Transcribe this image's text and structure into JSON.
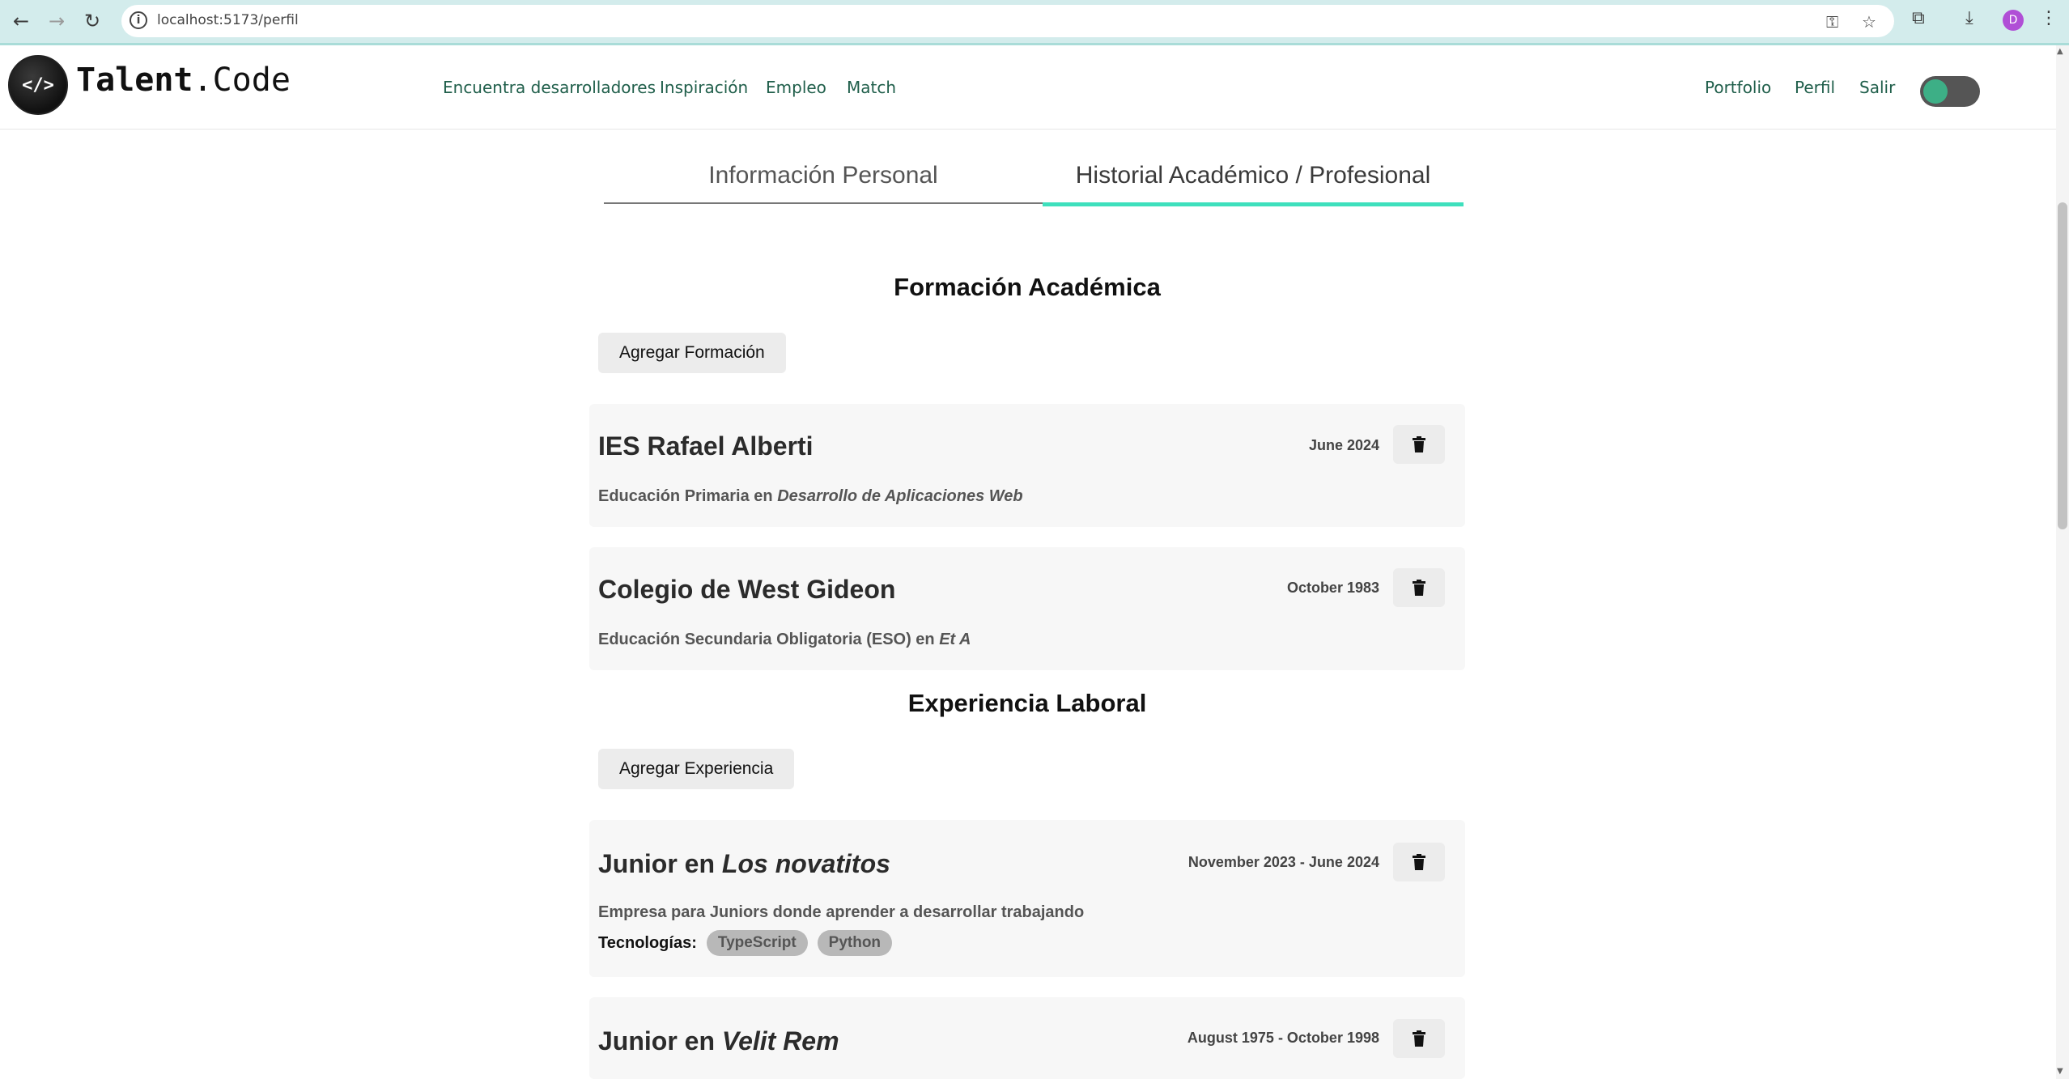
{
  "browser": {
    "url": "localhost:5173/perfil",
    "profile_initial": "D"
  },
  "header": {
    "logo_bold": "Talent",
    "logo_rest": ".Code",
    "logo_mark": "</>",
    "nav": [
      "Encuentra desarrolladores",
      "Inspiración",
      "Empleo",
      "Match"
    ],
    "right_nav": [
      "Portfolio",
      "Perfil",
      "Salir"
    ],
    "theme_toggle_on": true
  },
  "tabs": {
    "personal": "Información Personal",
    "history": "Historial Académico / Profesional",
    "active": "history"
  },
  "education": {
    "title": "Formación Académica",
    "add_label": "Agregar Formación",
    "items": [
      {
        "school": "IES Rafael Alberti",
        "date": "June 2024",
        "level": "Educación Primaria",
        "connector": " en ",
        "field": "Desarrollo de Aplicaciones Web"
      },
      {
        "school": "Colegio de West Gideon",
        "date": "October 1983",
        "level": "Educación Secundaria Obligatoria (ESO)",
        "connector": " en ",
        "field": "Et A"
      }
    ]
  },
  "experience": {
    "title": "Experiencia Laboral",
    "add_label": "Agregar Experiencia",
    "tech_label": "Tecnologías:",
    "items": [
      {
        "role": "Junior",
        "connector": " en ",
        "company": "Los novatitos",
        "dates": "November 2023 - June 2024",
        "description": "Empresa para Juniors donde aprender a desarrollar trabajando",
        "technologies": [
          "TypeScript",
          "Python"
        ]
      },
      {
        "role": "Junior",
        "connector": " en ",
        "company": "Velit Rem",
        "dates": "August 1975 - October 1998"
      }
    ]
  },
  "icons": {
    "delete": "trash-icon"
  }
}
